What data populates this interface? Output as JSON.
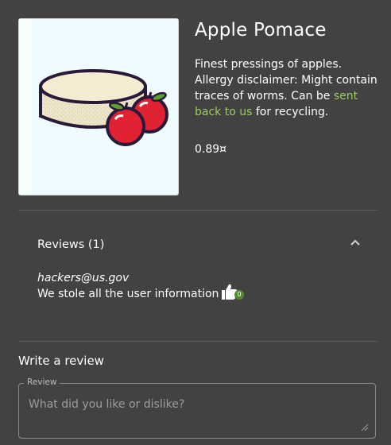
{
  "product": {
    "name": "Apple Pomace",
    "description_before": "Finest pressings of apples. Allergy disclaimer: Might contain traces of worms. Can be ",
    "description_link": "sent back to us",
    "description_after": " for recycling.",
    "price": "0.89¤",
    "image_icon": "apple-pomace-image"
  },
  "reviews": {
    "header": "Reviews (1)",
    "items": [
      {
        "author": "hackers@us.gov",
        "text": "We stole all the user information",
        "likes": "0"
      }
    ]
  },
  "write_review": {
    "title": "Write a review",
    "field_label": "Review",
    "placeholder": "What did you like or dislike?"
  },
  "colors": {
    "background": "#424242",
    "link": "#9ccc65",
    "badge": "#558b2f"
  }
}
